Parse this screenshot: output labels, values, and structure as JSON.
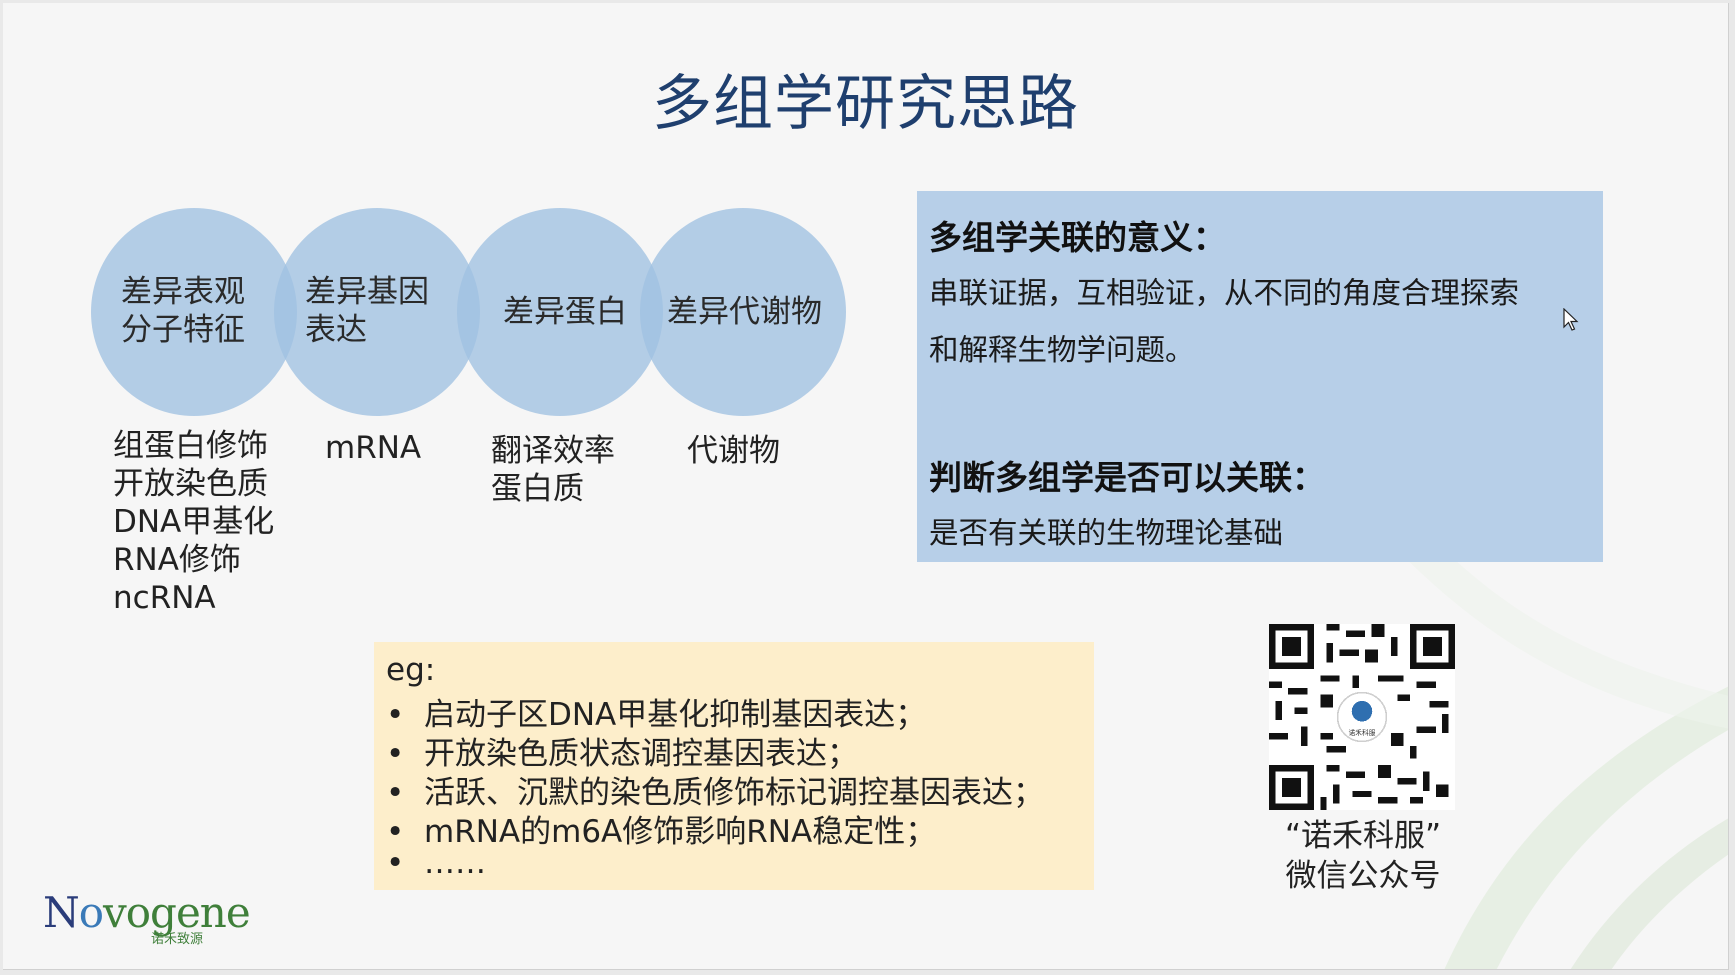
{
  "title": "多组学研究思路",
  "circles": [
    "差异表观\n分子特征",
    "差异基因\n表达",
    "差异蛋白",
    "差异代谢物"
  ],
  "under_circles": [
    "组蛋白修饰\n开放染色质\nDNA甲基化\nRNA修饰\nncRNA",
    "mRNA",
    "翻译效率\n蛋白质",
    "代谢物"
  ],
  "meaning_panel": {
    "heading1": "多组学关联的意义：",
    "text1_line1": "串联证据，互相验证，从不同的角度合理探索",
    "text1_line2": "和解释生物学问题。",
    "heading2": "判断多组学是否可以关联：",
    "text2": "是否有关联的生物理论基础"
  },
  "example_box": {
    "heading": "eg:",
    "bullet_symbol": "•",
    "items": [
      "启动子区DNA甲基化抑制基因表达；",
      "开放染色质状态调控基因表达；",
      "活跃、沉默的染色质修饰标记调控基因表达；",
      "mRNA的m6A修饰影响RNA稳定性；",
      "……"
    ]
  },
  "qr": {
    "center_label": "诺禾科服",
    "caption_line1": "“诺禾科服”",
    "caption_line2": "微信公众号"
  },
  "logo": {
    "part1": "N",
    "part2": "o",
    "part3": "vogene",
    "sub": "诺禾致源"
  },
  "colors": {
    "title": "#1f3f6e",
    "circle": "#a0c2e2",
    "panel": "#b7cfe8",
    "example_bg": "#fdeecb",
    "logo_blue": "#2a3c7a",
    "logo_green": "#3f7f3a"
  }
}
